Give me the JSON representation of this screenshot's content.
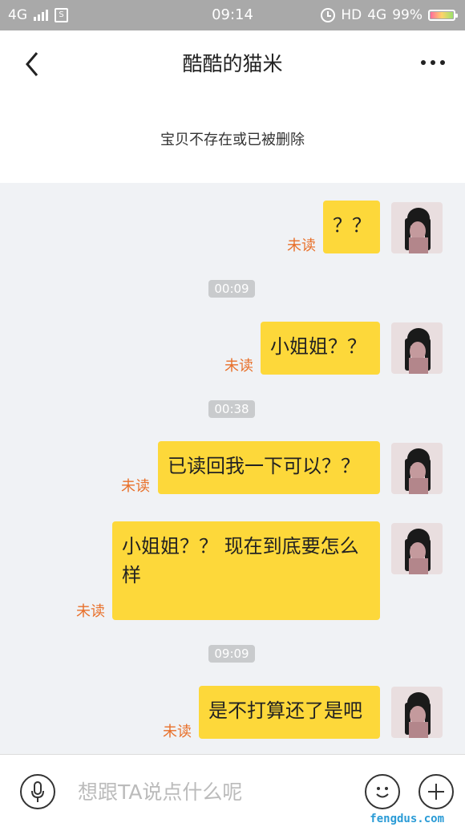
{
  "status_bar": {
    "network_left": "4G",
    "time": "09:14",
    "hd": "HD",
    "network_right": "4G",
    "battery_percent": "99%",
    "battery_level": 0.99
  },
  "header": {
    "title": "酷酷的猫米"
  },
  "notice": {
    "text": "宝贝不存在或已被删除"
  },
  "messages": [
    {
      "text": "？？",
      "status": "未读"
    },
    {
      "timestamp": "00:09"
    },
    {
      "text": "小姐姐？？",
      "status": "未读"
    },
    {
      "timestamp": "00:38"
    },
    {
      "text": "已读回我一下可以？？",
      "status": "未读"
    },
    {
      "text": "小姐姐？？ 现在到底要怎么样",
      "status": "未读"
    },
    {
      "timestamp": "09:09"
    },
    {
      "text": "是不打算还了是吧",
      "status": "未读"
    }
  ],
  "input_bar": {
    "placeholder": "想跟TA说点什么呢"
  },
  "watermark": "fengdus.com",
  "colors": {
    "bubble": "#fdd83a",
    "unread": "#e8702a",
    "status_bar": "#a9a9a9"
  }
}
